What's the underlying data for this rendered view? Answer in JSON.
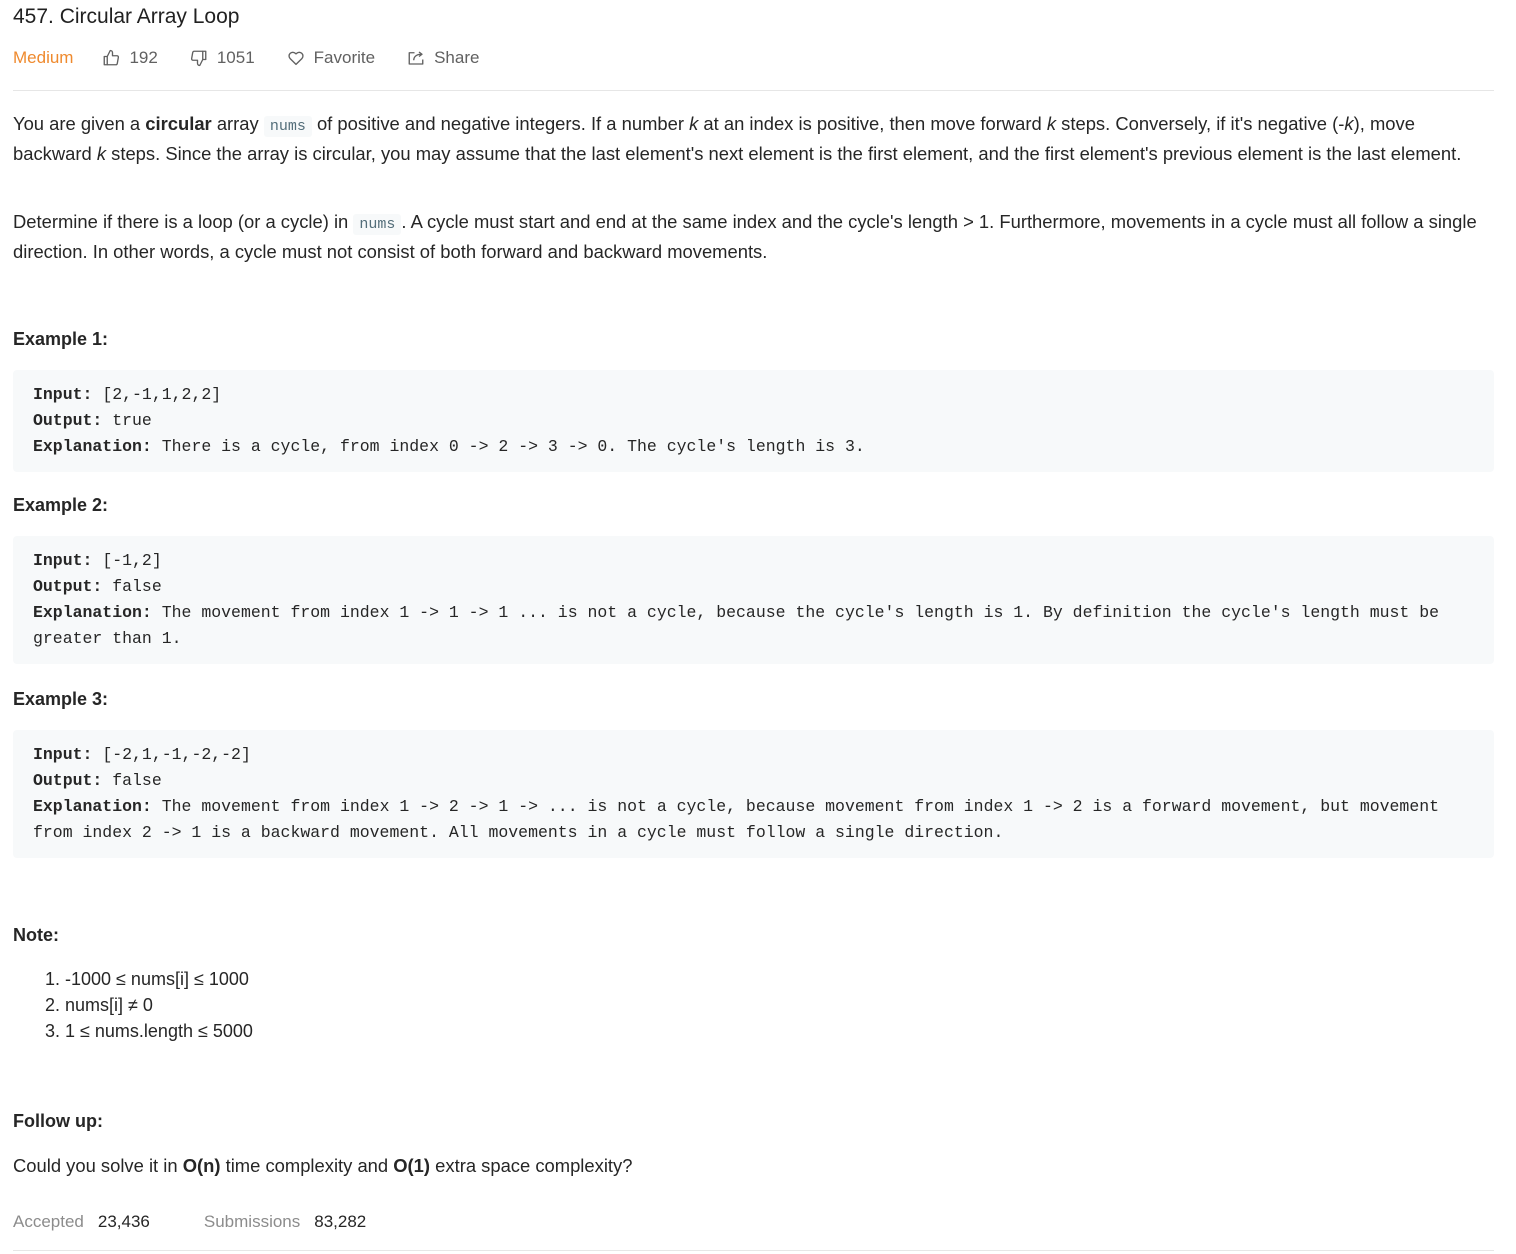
{
  "problem": {
    "title": "457. Circular Array Loop",
    "difficulty": "Medium",
    "likes": "192",
    "dislikes": "1051",
    "favorite_label": "Favorite",
    "share_label": "Share"
  },
  "description": {
    "p1": {
      "a": "You are given a ",
      "b": "circular",
      "c": " array ",
      "code": "nums",
      "d": " of positive and negative integers. If a number ",
      "k1": "k",
      "e": " at an index is positive, then move forward ",
      "k2": "k",
      "f": " steps. Conversely, if it's negative (-",
      "k3": "k",
      "g": "), move backward ",
      "k4": "k",
      "h": " steps. Since the array is circular, you may assume that the last element's next element is the first element, and the first element's previous element is the last element."
    },
    "p2": {
      "a": "Determine if there is a loop (or a cycle) in ",
      "code": "nums",
      "b": ". A cycle must start and end at the same index and the cycle's length > 1. Furthermore, movements in a cycle must all follow a single direction. In other words, a cycle must not consist of both forward and backward movements."
    }
  },
  "examples": [
    {
      "heading": "Example 1:",
      "input_label": "Input:",
      "input": "[2,-1,1,2,2]",
      "output_label": "Output:",
      "output": "true",
      "explanation_label": "Explanation:",
      "explanation": "There is a cycle, from index 0 -> 2 -> 3 -> 0. The cycle's length is 3."
    },
    {
      "heading": "Example 2:",
      "input_label": "Input:",
      "input": "[-1,2]",
      "output_label": "Output:",
      "output": "false",
      "explanation_label": "Explanation:",
      "explanation": "The movement from index 1 -> 1 -> 1 ... is not a cycle, because the cycle's length is 1. By definition the cycle's length must be greater than 1."
    },
    {
      "heading": "Example 3:",
      "input_label": "Input:",
      "input": "[-2,1,-1,-2,-2]",
      "output_label": "Output:",
      "output": "false",
      "explanation_label": "Explanation:",
      "explanation": "The movement from index 1 -> 2 -> 1 -> ... is not a cycle, because movement from index 1 -> 2 is a forward movement, but movement from index 2 -> 1 is a backward movement. All movements in a cycle must follow a single direction."
    }
  ],
  "note": {
    "heading": "Note:",
    "items": [
      "1. -1000 ≤ nums[i] ≤ 1000",
      "2. nums[i] ≠ 0",
      "3. 1 ≤ nums.length ≤ 5000"
    ]
  },
  "follow_up": {
    "heading": "Follow up:",
    "a": "Could you solve it in ",
    "b": "O(n)",
    "c": " time complexity and ",
    "d": "O(1)",
    "e": " extra space complexity?"
  },
  "stats": {
    "accepted_label": "Accepted",
    "accepted_value": "23,436",
    "submissions_label": "Submissions",
    "submissions_value": "83,282"
  },
  "colors": {
    "difficulty_medium": "#ef8a2e",
    "code_bg": "#f7f9fa",
    "code_text": "#546e7a",
    "divider": "#e6e6e6"
  }
}
